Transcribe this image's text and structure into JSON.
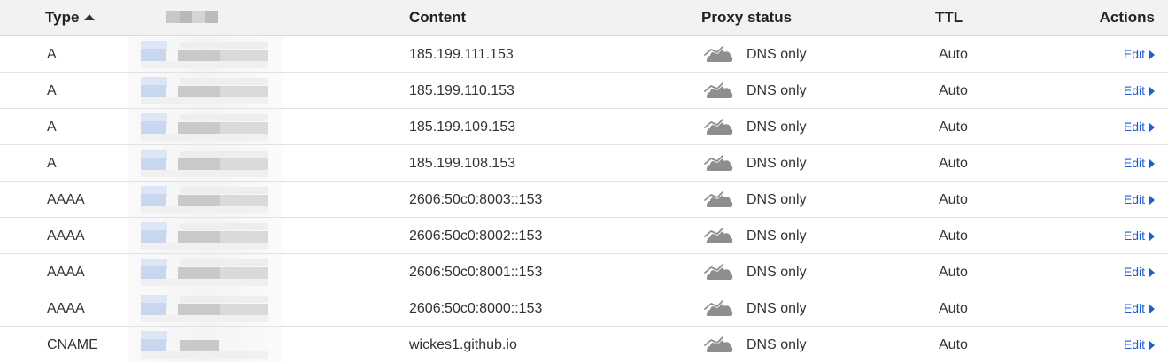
{
  "header": {
    "type": "Type",
    "content": "Content",
    "proxy_status": "Proxy status",
    "ttl": "TTL",
    "actions": "Actions"
  },
  "accent_color": "#1f5fcd",
  "icons": {
    "sort": "sort-ascending-icon",
    "proxy": "cloud-dns-only-icon",
    "edit": "caret-right-icon"
  },
  "records": [
    {
      "type": "A",
      "content": "185.199.111.153",
      "proxy": "DNS only",
      "ttl": "Auto",
      "action": "Edit"
    },
    {
      "type": "A",
      "content": "185.199.110.153",
      "proxy": "DNS only",
      "ttl": "Auto",
      "action": "Edit"
    },
    {
      "type": "A",
      "content": "185.199.109.153",
      "proxy": "DNS only",
      "ttl": "Auto",
      "action": "Edit"
    },
    {
      "type": "A",
      "content": "185.199.108.153",
      "proxy": "DNS only",
      "ttl": "Auto",
      "action": "Edit"
    },
    {
      "type": "AAAA",
      "content": "2606:50c0:8003::153",
      "proxy": "DNS only",
      "ttl": "Auto",
      "action": "Edit"
    },
    {
      "type": "AAAA",
      "content": "2606:50c0:8002::153",
      "proxy": "DNS only",
      "ttl": "Auto",
      "action": "Edit"
    },
    {
      "type": "AAAA",
      "content": "2606:50c0:8001::153",
      "proxy": "DNS only",
      "ttl": "Auto",
      "action": "Edit"
    },
    {
      "type": "AAAA",
      "content": "2606:50c0:8000::153",
      "proxy": "DNS only",
      "ttl": "Auto",
      "action": "Edit"
    },
    {
      "type": "CNAME",
      "content": "wickes1.github.io",
      "proxy": "DNS only",
      "ttl": "Auto",
      "action": "Edit"
    }
  ]
}
